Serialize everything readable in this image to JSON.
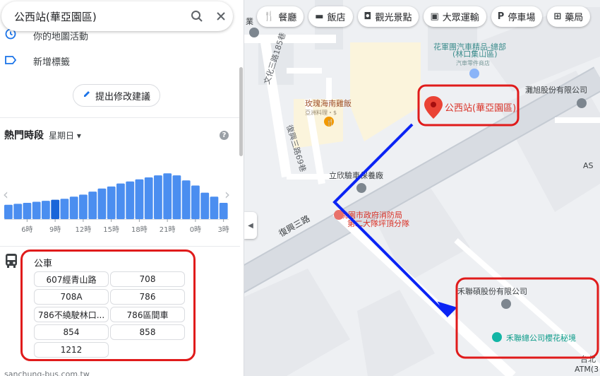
{
  "search": {
    "query": "公西站(華亞園區)"
  },
  "panel": {
    "links": [
      {
        "label": "你的地圖活動",
        "icon": "history-icon"
      },
      {
        "label": "新增標籤",
        "icon": "label-icon"
      }
    ],
    "suggest_edit": "提出修改建議",
    "popular_times": {
      "title": "熱門時段",
      "day": "星期日"
    },
    "transit": {
      "type": "公車",
      "routes": [
        "607經青山路",
        "708",
        "708A",
        "786",
        "786不繞駛林口...",
        "786區間車",
        "854",
        "858",
        "1212"
      ]
    },
    "website_peek": "sanchung-bus.com.tw"
  },
  "chart_data": {
    "type": "bar",
    "title": "",
    "categories": [
      "4",
      "5",
      "6",
      "7",
      "8",
      "9",
      "10",
      "11",
      "12",
      "13",
      "14",
      "15",
      "16",
      "17",
      "18",
      "19",
      "20",
      "21",
      "22",
      "23",
      "0",
      "1",
      "2",
      "3"
    ],
    "x_tick_labels": [
      "6時",
      "9時",
      "12時",
      "15時",
      "18時",
      "21時",
      "0時",
      "3時"
    ],
    "values": [
      14,
      15,
      16,
      17,
      18,
      19,
      20,
      22,
      24,
      27,
      30,
      32,
      35,
      37,
      39,
      41,
      43,
      45,
      43,
      38,
      33,
      26,
      22,
      16
    ],
    "highlight_index": 5,
    "ylim": [
      0,
      50
    ],
    "colors": {
      "bar": "#4b8ef0",
      "highlight": "#1a66d9",
      "baseline": "#dadce0"
    }
  },
  "map": {
    "categories": [
      {
        "label": "餐廳",
        "icon": "fork-knife-icon"
      },
      {
        "label": "飯店",
        "icon": "bed-icon"
      },
      {
        "label": "觀光景點",
        "icon": "camera-icon"
      },
      {
        "label": "大眾運輸",
        "icon": "train-icon"
      },
      {
        "label": "停車場",
        "icon": "parking-icon"
      },
      {
        "label": "藥局",
        "icon": "pharmacy-icon"
      }
    ],
    "selected_place": "公西站(華亞園區)",
    "labels": {
      "rose": "玫瑰海南雞飯",
      "rose_sub": "亞洲料理・$",
      "huajun": "花軍團汽車精品-總部",
      "huajun2": "(林口集山區)",
      "huajun_sub": "汽車零件商店",
      "tanxu": "灘旭股份有限公司",
      "lixin": "立欣驗車保養廠",
      "fire": "桃園市政府消防局",
      "fire2": "第二大隊坪頂分隊",
      "helian": "禾聯碩股份有限公司",
      "helian2": "禾聯總公司櫻花秘境",
      "road_wenhua": "文化三路185巷",
      "road_fuxing": "復興三路",
      "road_fuxing69": "復興三路69巷",
      "edge_1": "AS",
      "edge_2": "台北",
      "edge_3": "ATM(3",
      "edge_4": "業"
    }
  }
}
